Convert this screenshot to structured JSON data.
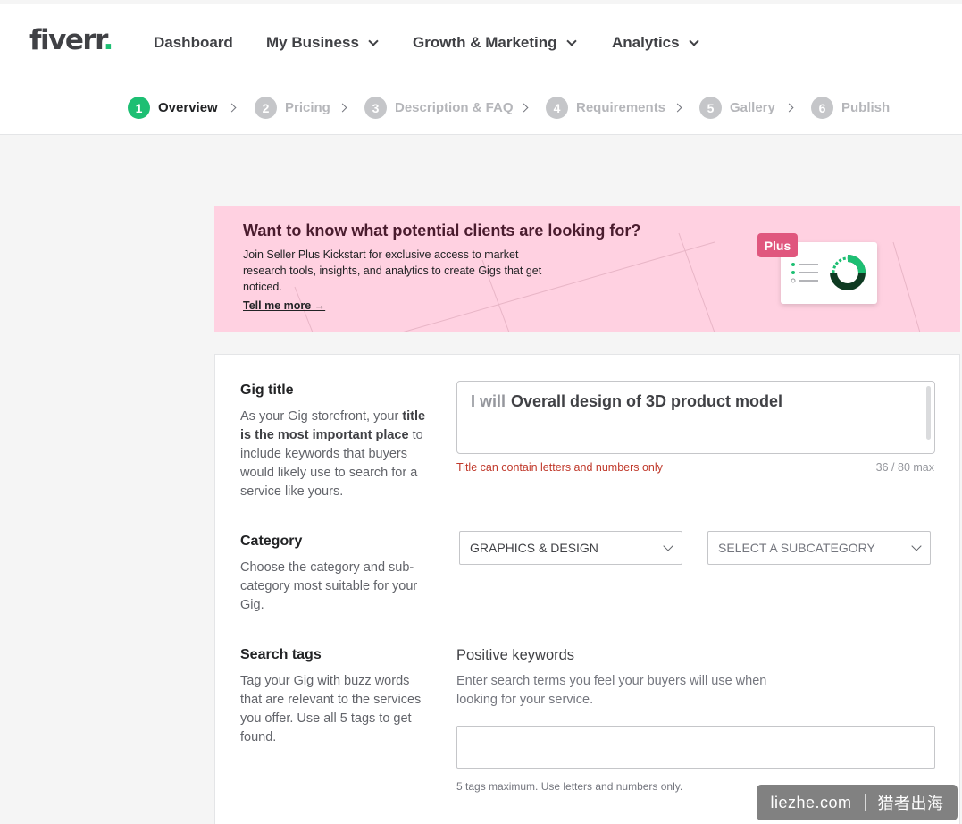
{
  "header": {
    "logo": "fiverr",
    "logo_dot": ".",
    "nav": [
      {
        "label": "Dashboard"
      },
      {
        "label": "My Business"
      },
      {
        "label": "Growth & Marketing"
      },
      {
        "label": "Analytics"
      }
    ]
  },
  "steps": [
    {
      "num": "1",
      "label": "Overview",
      "active": true
    },
    {
      "num": "2",
      "label": "Pricing"
    },
    {
      "num": "3",
      "label": "Description & FAQ"
    },
    {
      "num": "4",
      "label": "Requirements"
    },
    {
      "num": "5",
      "label": "Gallery"
    },
    {
      "num": "6",
      "label": "Publish"
    }
  ],
  "banner": {
    "title": "Want to know what potential clients are looking for?",
    "body": "Join Seller Plus Kickstart for exclusive access to market research tools, insights, and analytics to create Gigs that get noticed.",
    "link": "Tell me more →",
    "badge": "Plus"
  },
  "gig_title": {
    "label": "Gig title",
    "desc_pre": "As your Gig storefront, your ",
    "desc_bold": "title is the most important place",
    "desc_post": " to include keywords that buyers would likely use to search for a service like yours.",
    "prefix": "I will",
    "value": "Overall design of 3D product model",
    "error": "Title can contain letters and numbers only",
    "counter": "36 / 80 max"
  },
  "category": {
    "label": "Category",
    "desc": "Choose the category and sub-category most suitable for your Gig.",
    "selected": "GRAPHICS & DESIGN",
    "sub_placeholder": "SELECT A SUBCATEGORY"
  },
  "search_tags": {
    "label": "Search tags",
    "desc": "Tag your Gig with buzz words that are relevant to the services you offer. Use all 5 tags to get found.",
    "pos_label": "Positive keywords",
    "pos_desc": "Enter search terms you feel your buyers will use when looking for your service.",
    "hint": "5 tags maximum. Use letters and numbers only."
  },
  "watermark": {
    "left": "liezhe.com",
    "right": "猎者出海"
  },
  "colors": {
    "brand_green": "#1dbf73",
    "banner_bg": "#ffd1e1",
    "plus_badge": "#e0577e",
    "error": "#c0392b"
  }
}
